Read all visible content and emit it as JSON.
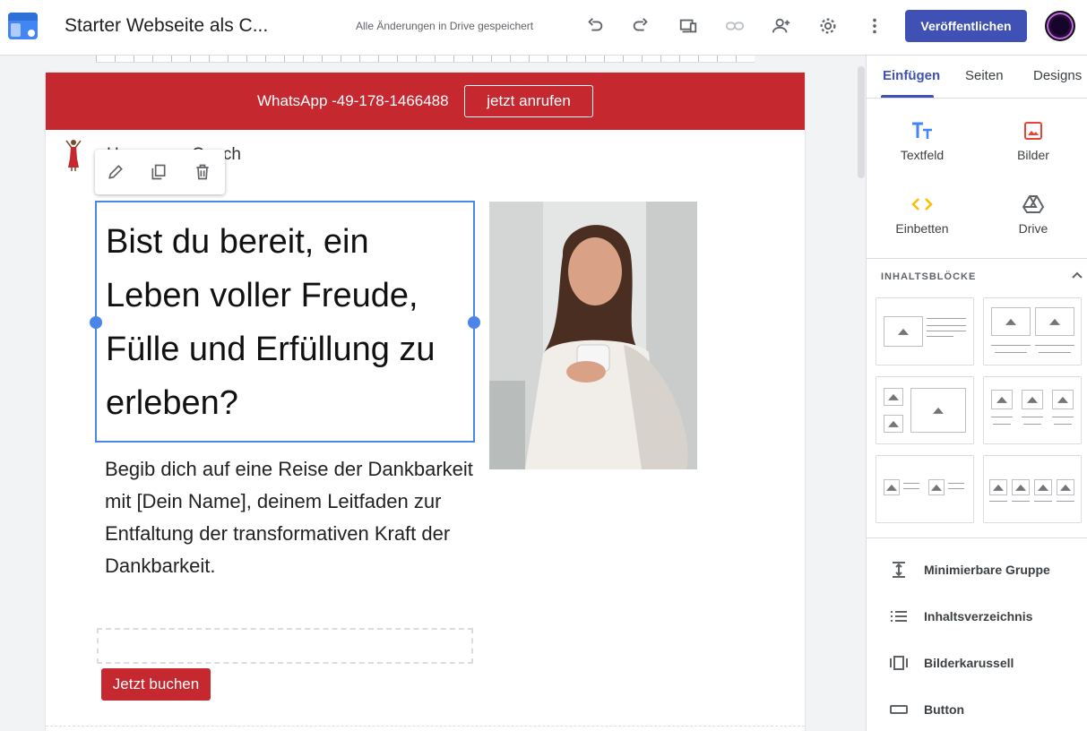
{
  "app": {
    "title": "Starter Webseite als C...",
    "save_status": "Alle Änderungen in Drive gespeichert",
    "publish_label": "Veröffentlichen",
    "brand_color": "#3f51b5"
  },
  "toolbar_icons": [
    "undo-icon",
    "redo-icon",
    "preview-icon",
    "link-icon",
    "share-icon",
    "settings-icon",
    "more-icon"
  ],
  "site": {
    "banner_text": "WhatsApp -49-178-1466488",
    "banner_button": "jetzt anrufen",
    "banner_color": "#c62830",
    "site_name": "Hxxxxxxxs Coach",
    "headline": "Bist du bereit, ein Leben voller Freude, Fülle und Erfüllung zu erleben?",
    "paragraph": "Begib dich auf eine Reise der Dankbarkeit mit [Dein Name], deinem Leitfaden zur Entfaltung der transformativen Kraft der Dankbarkeit.",
    "book_button": "Jetzt buchen"
  },
  "mini_toolbar": [
    "edit-icon",
    "duplicate-icon",
    "delete-icon"
  ],
  "panel": {
    "tabs": [
      {
        "label": "Einfügen",
        "active": true
      },
      {
        "label": "Seiten",
        "active": false
      },
      {
        "label": "Designs",
        "active": false
      }
    ],
    "insert_items": [
      {
        "label": "Textfeld",
        "icon": "text-icon"
      },
      {
        "label": "Bilder",
        "icon": "image-icon"
      },
      {
        "label": "Einbetten",
        "icon": "embed-icon"
      },
      {
        "label": "Drive",
        "icon": "drive-icon"
      }
    ],
    "blocks_heading": "INHALTSBLÖCKE",
    "components": [
      {
        "label": "Minimierbare Gruppe",
        "icon": "collapsible-group-icon"
      },
      {
        "label": "Inhaltsverzeichnis",
        "icon": "toc-icon"
      },
      {
        "label": "Bilderkarussell",
        "icon": "carousel-icon"
      },
      {
        "label": "Button",
        "icon": "button-icon"
      }
    ]
  }
}
